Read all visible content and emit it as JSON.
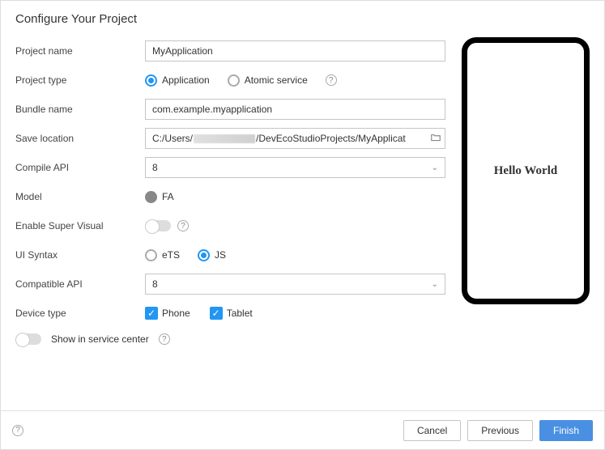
{
  "title": "Configure Your Project",
  "form": {
    "project_name": {
      "label": "Project name",
      "value": "MyApplication"
    },
    "project_type": {
      "label": "Project type",
      "options": {
        "application": "Application",
        "atomic": "Atomic service"
      },
      "selected": "application"
    },
    "bundle_name": {
      "label": "Bundle name",
      "value": "com.example.myapplication"
    },
    "save_location": {
      "label": "Save location",
      "prefix": "C:/Users/",
      "suffix": "/DevEcoStudioProjects/MyApplicat"
    },
    "compile_api": {
      "label": "Compile API",
      "value": "8"
    },
    "model": {
      "label": "Model",
      "value": "FA"
    },
    "super_visual": {
      "label": "Enable Super Visual",
      "on": false
    },
    "ui_syntax": {
      "label": "UI Syntax",
      "options": {
        "ets": "eTS",
        "js": "JS"
      },
      "selected": "js"
    },
    "compatible_api": {
      "label": "Compatible API",
      "value": "8"
    },
    "device_type": {
      "label": "Device type",
      "items": [
        {
          "label": "Phone",
          "checked": true
        },
        {
          "label": "Tablet",
          "checked": true
        }
      ]
    },
    "service_center": {
      "label": "Show in service center",
      "on": false
    }
  },
  "preview": {
    "text": "Hello World"
  },
  "footer": {
    "cancel": "Cancel",
    "previous": "Previous",
    "finish": "Finish"
  }
}
